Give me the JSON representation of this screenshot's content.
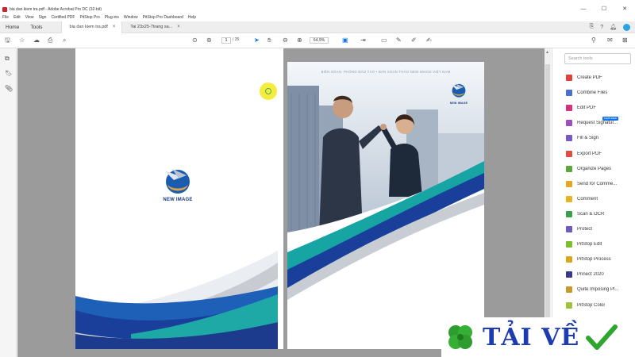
{
  "window": {
    "title": "bia dan kiem tra.pdf - Adobe Acrobat Pro DC (32-bit)",
    "controls": [
      "—",
      "☐",
      "✕"
    ]
  },
  "menu": [
    "File",
    "Edit",
    "View",
    "Sign",
    "Certified PDF",
    "PitStop Pro",
    "Plug-ins",
    "Window",
    "PitStop Pro Dashboard",
    "Help"
  ],
  "tabs": {
    "home": "Home",
    "tools": "Tools",
    "documents": [
      {
        "label": "bia dan kiem tra.pdf",
        "close": "×"
      },
      {
        "label": "Tai 23x25-7trang sa...",
        "close": "×"
      }
    ]
  },
  "toolbar": {
    "page_current": "1",
    "page_total": "/ 35",
    "zoom": "64,9%"
  },
  "document": {
    "left_logo_text": "NEW IMAGE",
    "right_logo_text": "NEW IMAGE",
    "banner_text": "BIÊN SOẠN: PHÒNG ĐÀO TẠO • BAN SOẠN THẢO NEW IMAGE VIỆT NAM"
  },
  "tools_pane": {
    "search_placeholder": "Search tools",
    "featured_badge": "FEATURED",
    "items": [
      {
        "label": "Create PDF",
        "color": "#e0413b"
      },
      {
        "label": "Combine Files",
        "color": "#4a6fd1"
      },
      {
        "label": "Edit PDF",
        "color": "#d8327d"
      },
      {
        "label": "Request Signatur...",
        "color": "#9d4fc0"
      },
      {
        "label": "Fill & Sign",
        "color": "#7a58c7"
      },
      {
        "label": "Export PDF",
        "color": "#e24b3f"
      },
      {
        "label": "Organize Pages",
        "color": "#5aa83b"
      },
      {
        "label": "Send for Comme...",
        "color": "#e6a520"
      },
      {
        "label": "Comment",
        "color": "#e6b422"
      },
      {
        "label": "Scan & OCR",
        "color": "#3aa04a"
      },
      {
        "label": "Protect",
        "color": "#6e5ac2"
      },
      {
        "label": "PitStop Edit",
        "color": "#7bbf2a"
      },
      {
        "label": "PitStop Process",
        "color": "#d8a81c"
      },
      {
        "label": "Prinect 2020",
        "color": "#3a3a8a"
      },
      {
        "label": "Quite Imposing Pl...",
        "color": "#c89a2a"
      },
      {
        "label": "PitStop Color",
        "color": "#9cc43a"
      }
    ]
  },
  "watermark": {
    "text": "TẢI VỀ"
  }
}
